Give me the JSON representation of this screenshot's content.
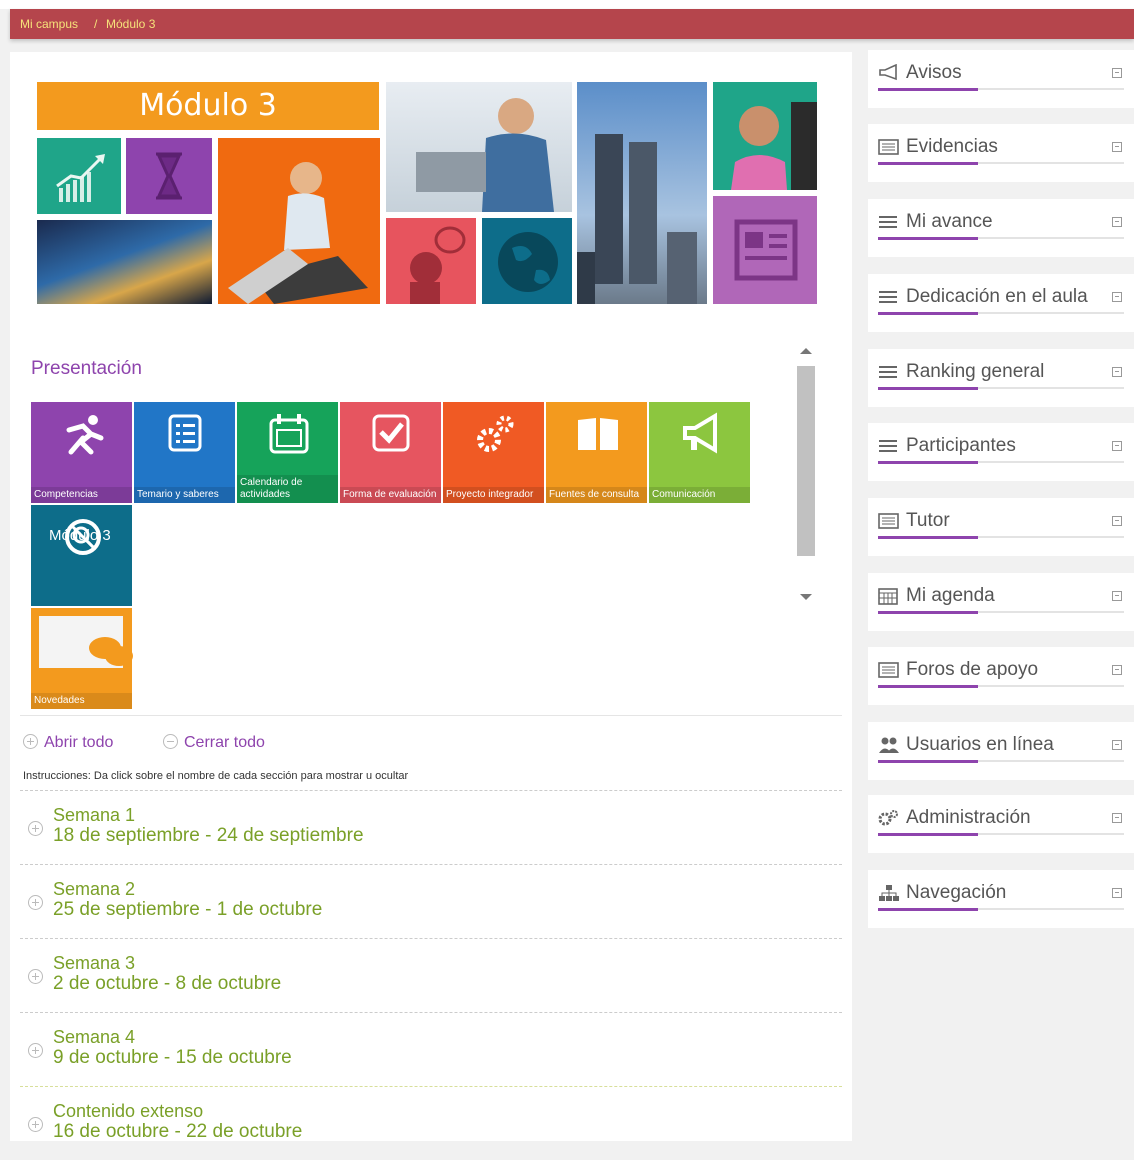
{
  "breadcrumb": {
    "home": "Mi campus",
    "separator": "/",
    "current": "Módulo 3"
  },
  "banner": {
    "title": "Módulo 3"
  },
  "presentation": {
    "title": "Presentación",
    "apps": [
      {
        "label": "Competencias",
        "color": "#8e44ad",
        "icon": "runner-icon"
      },
      {
        "label": "Temario y saberes",
        "color": "#2176c7",
        "icon": "list-icon"
      },
      {
        "label": "Calendario de actividades",
        "color": "#16a35a",
        "icon": "calendar-icon"
      },
      {
        "label": "Forma de evaluación",
        "color": "#e65560",
        "icon": "check-icon"
      },
      {
        "label": "Proyecto integrador",
        "color": "#f05a24",
        "icon": "gears-icon"
      },
      {
        "label": "Fuentes de consulta",
        "color": "#f39a1e",
        "icon": "book-icon"
      },
      {
        "label": "Comunicación",
        "color": "#8cc63f",
        "icon": "megaphone-icon"
      }
    ],
    "module_tile": {
      "label": "Módulo 3",
      "color": "#0d6d8a",
      "icon": "no-search-icon"
    },
    "news_tile": {
      "label": "Novedades",
      "color": "#f39a1e",
      "icon": "chat-icon"
    }
  },
  "controls": {
    "open_all": "Abrir todo",
    "close_all": "Cerrar todo",
    "instructions": "Instrucciones: Da click sobre el nombre de cada sección para mostrar u ocultar"
  },
  "weeks": [
    {
      "name": "Semana 1",
      "dates": "18 de septiembre - 24 de septiembre"
    },
    {
      "name": "Semana 2",
      "dates": "25 de septiembre - 1 de octubre"
    },
    {
      "name": "Semana 3",
      "dates": "2 de octubre - 8 de octubre"
    },
    {
      "name": "Semana 4",
      "dates": "9 de octubre - 15 de octubre"
    },
    {
      "name": "Contenido extenso",
      "dates": "16 de octubre - 22 de octubre"
    }
  ],
  "sidebar": [
    {
      "label": "Avisos",
      "icon": "megaphone-icon"
    },
    {
      "label": "Evidencias",
      "icon": "list-icon"
    },
    {
      "label": "Mi avance",
      "icon": "bars-icon"
    },
    {
      "label": "Dedicación en el aula",
      "icon": "bars-icon"
    },
    {
      "label": "Ranking general",
      "icon": "bars-icon"
    },
    {
      "label": "Participantes",
      "icon": "bars-icon"
    },
    {
      "label": "Tutor",
      "icon": "list-icon"
    },
    {
      "label": "Mi agenda",
      "icon": "calendar-icon"
    },
    {
      "label": "Foros de apoyo",
      "icon": "list-icon"
    },
    {
      "label": "Usuarios en línea",
      "icon": "users-icon"
    },
    {
      "label": "Administración",
      "icon": "gears-icon"
    },
    {
      "label": "Navegación",
      "icon": "sitemap-icon"
    }
  ],
  "colors": {
    "accent": "#8e44ad",
    "week_text": "#7aa028",
    "header": "#b5454c",
    "crumb": "#f6e27a"
  }
}
